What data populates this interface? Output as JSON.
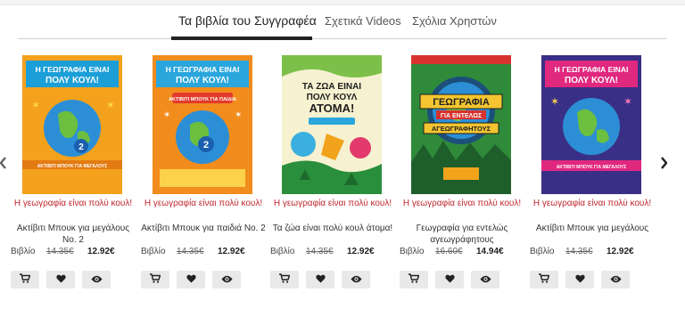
{
  "tabs": [
    {
      "label": "Τα βιβλία του Συγγραφέα",
      "active": true
    },
    {
      "label": "Σχετικά Videos",
      "active": false
    },
    {
      "label": "Σχόλια Χρηστών",
      "active": false
    }
  ],
  "nav": {
    "prev_icon": "chevron-left-icon",
    "next_icon": "chevron-right-icon"
  },
  "books": [
    {
      "title": "Η γεωγραφία είναι πολύ κουλ!",
      "subtitle": "Ακτίβιτι Μπουκ για μεγάλους Νο. 2",
      "format": "Βιβλίο",
      "old_price": "14.35€",
      "price": "12.92€",
      "cover": {
        "headline_1": "Η ΓΕΩΓΡΑΦΙΑ ΕΙΝΑΙ",
        "headline_2": "ΠΟΛΥ ΚΟΥΛ!",
        "badge": "2",
        "band": "ΑΚΤΙΒΙΤΙ ΜΠΟΥΚ ΓΙΑ ΜΕΓΑΛΟΥΣ",
        "bg": "#f4a11c",
        "banner": "#1c9fd8"
      }
    },
    {
      "title": "Η γεωγραφία είναι πολύ κουλ!",
      "subtitle": "Ακτίβιτι Μπουκ για παιδιά Νο. 2",
      "format": "Βιβλίο",
      "old_price": "14.35€",
      "price": "12.92€",
      "cover": {
        "headline_1": "Η ΓΕΩΓΡΑΦΙΑ ΕΙΝΑΙ",
        "headline_2": "ΠΟΛΥ ΚΟΥΛ!",
        "badge": "2",
        "band": "ΑΚΤΙΒΙΤΙ ΜΠΟΥΚ ΓΙΑ ΠΑΙΔΙΑ",
        "bg": "#f28c1c",
        "banner": "#2aa6dd"
      }
    },
    {
      "title": "Η γεωγραφία είναι πολύ κουλ!",
      "subtitle": "Τα ζώα είναι πολύ κουλ άτομα!",
      "format": "Βιβλίο",
      "old_price": "14.35€",
      "price": "12.92€",
      "cover": {
        "headline_1": "ΤΑ ΖΩΑ ΕΙΝΑΙ",
        "headline_2": "ΠΟΛΥ ΚΟΥΛ",
        "headline_3": "ΑΤΟΜΑ!",
        "bg": "#f6f1d0",
        "banner": "#2a8f3c"
      }
    },
    {
      "title": "Η γεωγραφία είναι πολύ κουλ!",
      "subtitle": "Γεωγραφία για εντελώς αγεωγράφητους",
      "format": "Βιβλίο",
      "old_price": "16.60€",
      "price": "14.94€",
      "cover": {
        "headline_1": "ΓΕΩΓΡΑΦΙΑ",
        "headline_2": "ΓΙΑ ΕΝΤΕΛΩΣ",
        "headline_3": "ΑΓΕΩΓΡΑΦΗΤΟΥΣ",
        "bg": "#2f8a3a",
        "banner": "#d8322e"
      }
    },
    {
      "title": "Η γεωγραφία είναι πολύ κουλ!",
      "subtitle": "Ακτίβιτι Μπουκ για μεγάλους",
      "format": "Βιβλίο",
      "old_price": "14.35€",
      "price": "12.92€",
      "cover": {
        "headline_1": "Η ΓΕΩΓΡΑΦΙΑ ΕΙΝΑΙ",
        "headline_2": "ΠΟΛΥ ΚΟΥΛ!",
        "band": "ΑΚΤΙΒΙΤΙ ΜΠΟΥΚ ΓΙΑ ΜΕΓΑΛΟΥΣ",
        "bg": "#3a2f86",
        "banner": "#e0287f"
      }
    }
  ],
  "actions": {
    "cart_icon": "cart-icon",
    "wishlist_icon": "heart-icon",
    "preview_icon": "eye-icon"
  }
}
